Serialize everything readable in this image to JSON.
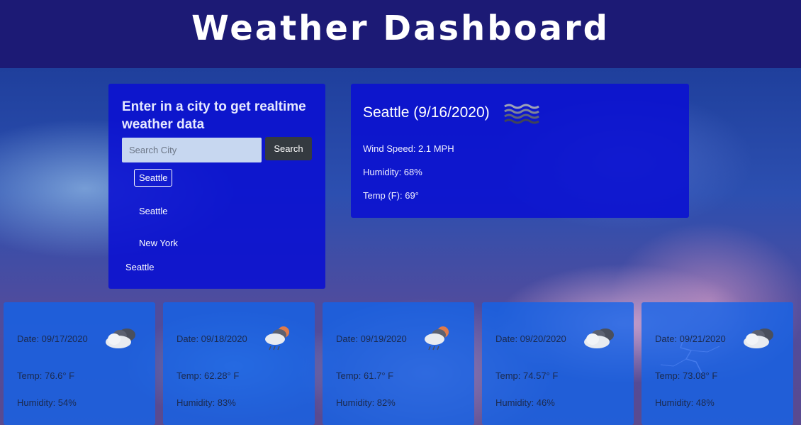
{
  "header": {
    "title": "Weather Dashboard"
  },
  "search": {
    "prompt": "Enter in a city to get realtime weather data",
    "placeholder": "Search City",
    "button_label": "Search",
    "history": [
      "Seattle",
      "Seattle",
      "New York",
      "Seattle"
    ]
  },
  "current": {
    "city_date": "Seattle (9/16/2020)",
    "icon": "mist-icon",
    "wind": "Wind Speed: 2.1 MPH",
    "humidity": "Humidity: 68%",
    "temp": "Temp (F): 69°"
  },
  "forecast": [
    {
      "date": "Date: 09/17/2020",
      "icon": "cloudy-icon",
      "temp": "Temp: 76.6° F",
      "humidity": "Humidity: 54%"
    },
    {
      "date": "Date: 09/18/2020",
      "icon": "rain-sun-icon",
      "temp": "Temp: 62.28° F",
      "humidity": "Humidity: 83%"
    },
    {
      "date": "Date: 09/19/2020",
      "icon": "rain-sun-icon",
      "temp": "Temp: 61.7° F",
      "humidity": "Humidity: 82%"
    },
    {
      "date": "Date: 09/20/2020",
      "icon": "cloudy-icon",
      "temp": "Temp: 74.57° F",
      "humidity": "Humidity: 46%"
    },
    {
      "date": "Date: 09/21/2020",
      "icon": "cloudy-icon",
      "temp": "Temp: 73.08° F",
      "humidity": "Humidity: 48%"
    }
  ],
  "colors": {
    "header_bg": "#1c1a75",
    "panel_bg": "#0a10d2",
    "card_bg": "#1264eb",
    "button_bg": "#343a40"
  }
}
